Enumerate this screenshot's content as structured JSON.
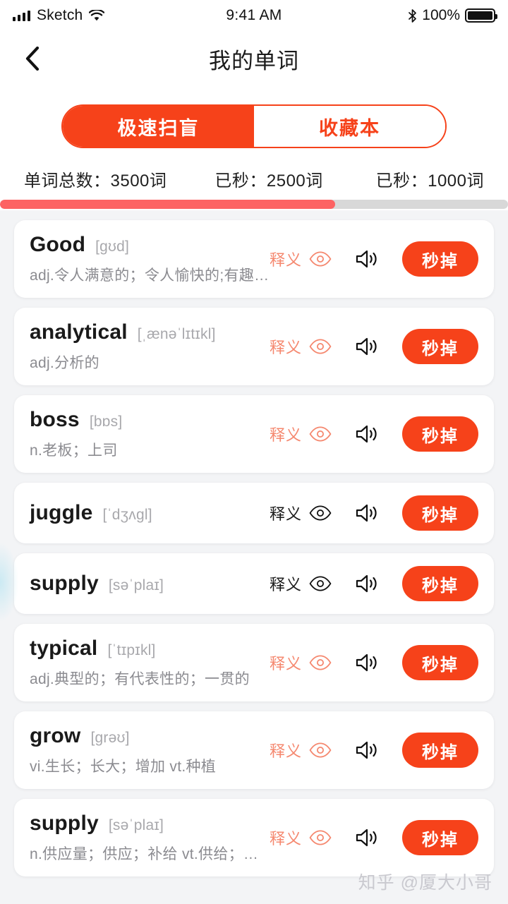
{
  "status_bar": {
    "carrier": "Sketch",
    "time": "9:41 AM",
    "battery_percent": "100%",
    "signal_icon": "signal-bars-icon",
    "wifi_icon": "wifi-icon",
    "bluetooth_icon": "bluetooth-icon",
    "battery_icon": "battery-full-icon"
  },
  "nav": {
    "back_icon": "chevron-left-icon",
    "title": "我的单词"
  },
  "tabs": [
    {
      "label": "极速扫盲",
      "active": true
    },
    {
      "label": "收藏本",
      "active": false
    }
  ],
  "stats": {
    "total": "单词总数：3500词",
    "done": "已秒：2500词",
    "remaining": "已秒：1000词",
    "progress_percent": 66
  },
  "colors": {
    "accent": "#F6421A",
    "accent_soft": "#F5886F",
    "progress_fill": "#FD6363",
    "progress_track": "#D8D8D8",
    "page_bg": "#F3F4F6",
    "card_bg": "#FFFFFF"
  },
  "action_labels": {
    "reveal": "释义",
    "kill": "秒掉",
    "eye_icon": "eye-icon",
    "speaker_icon": "speaker-icon"
  },
  "words": [
    {
      "word": "Good",
      "phonetic": "[gʊd]",
      "definition": "adj.令人满意的；令人愉快的;有趣的…",
      "reveal_active": true
    },
    {
      "word": "analytical",
      "phonetic": "[ˌænəˈlɪtɪkl]",
      "definition": "adj.分析的",
      "reveal_active": true
    },
    {
      "word": "boss",
      "phonetic": "[bɒs]",
      "definition": "n.老板；上司",
      "reveal_active": true
    },
    {
      "word": "juggle",
      "phonetic": "[ˈdʒʌgl]",
      "definition": "",
      "reveal_active": false
    },
    {
      "word": "supply",
      "phonetic": "[səˈplaɪ]",
      "definition": "",
      "reveal_active": false
    },
    {
      "word": "typical",
      "phonetic": "[ˈtɪpɪkl]",
      "definition": "adj.典型的；有代表性的；一贯的",
      "reveal_active": true
    },
    {
      "word": "grow",
      "phonetic": "[grəʊ]",
      "definition": "vi.生长；长大；增加  vt.种植",
      "reveal_active": true
    },
    {
      "word": "supply",
      "phonetic": "[səˈplaɪ]",
      "definition": "n.供应量；供应；补给  vt.供给；提供",
      "reveal_active": true
    }
  ],
  "watermark": "知乎 @厦大小哥"
}
